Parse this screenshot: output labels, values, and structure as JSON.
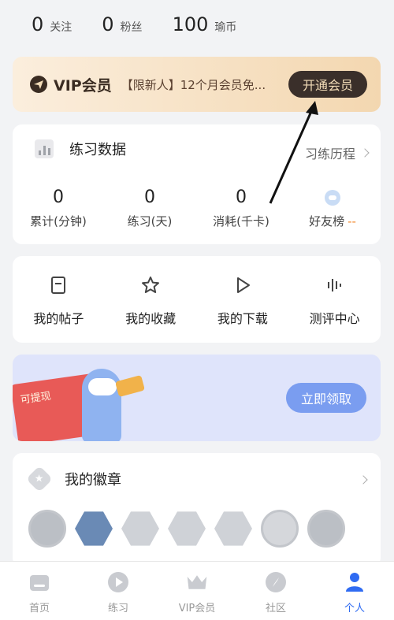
{
  "stats": [
    {
      "value": "0",
      "label": "关注"
    },
    {
      "value": "0",
      "label": "粉丝"
    },
    {
      "value": "100",
      "label": "瑜币"
    }
  ],
  "vip": {
    "title": "VIP会员",
    "promo": "【限新人】12个月会员免...",
    "button": "开通会员"
  },
  "practice": {
    "title": "练习数据",
    "history_link": "习练历程",
    "metrics": [
      {
        "value": "0",
        "label": "累计(分钟)"
      },
      {
        "value": "0",
        "label": "练习(天)"
      },
      {
        "value": "0",
        "label": "消耗(千卡)"
      }
    ],
    "friends_label": "好友榜",
    "friends_value": "--"
  },
  "shortcuts": [
    {
      "label": "我的帖子",
      "icon": "document-icon"
    },
    {
      "label": "我的收藏",
      "icon": "star-icon"
    },
    {
      "label": "我的下载",
      "icon": "play-icon"
    },
    {
      "label": "测评中心",
      "icon": "waveform-icon"
    }
  ],
  "banner": {
    "redpacket_label": "可提现",
    "button": "立即领取"
  },
  "badges": {
    "title": "我的徽章"
  },
  "tabbar": [
    {
      "label": "首页",
      "icon": "home-icon",
      "active": false
    },
    {
      "label": "练习",
      "icon": "play-circle-icon",
      "active": false
    },
    {
      "label": "VIP会员",
      "icon": "crown-icon",
      "active": false
    },
    {
      "label": "社区",
      "icon": "compass-icon",
      "active": false
    },
    {
      "label": "个人",
      "icon": "person-icon",
      "active": true
    }
  ],
  "colors": {
    "accent": "#2f6bf2",
    "vip_button_bg": "#3a2f2a",
    "vip_gold": "#f3ddb8",
    "claim_button_bg": "#7a9df0",
    "friends_dash": "#f28a2e"
  }
}
